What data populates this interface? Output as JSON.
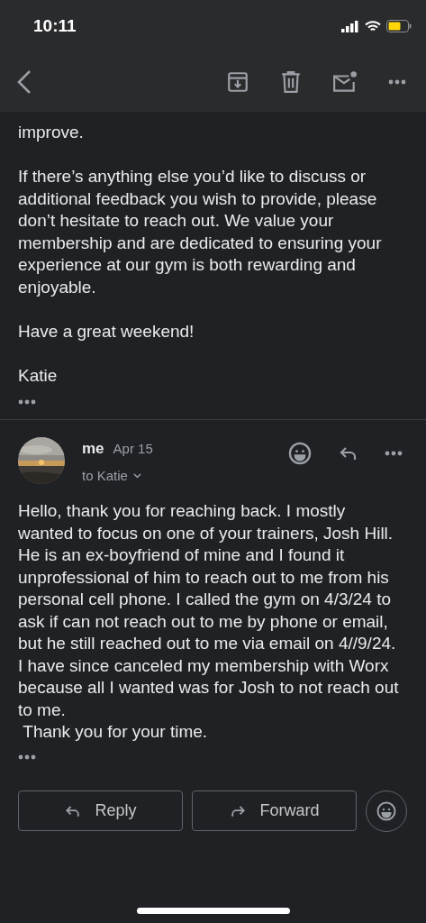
{
  "status_bar": {
    "time": "10:11"
  },
  "previous_message": {
    "paragraphs": [
      "improve.",
      "If there’s anything else you’d like to discuss or additional feedback you wish to provide, please don’t hesitate to reach out. We value your membership and are dedicated to ensuring your experience at our gym is both rewarding and enjoyable.",
      "Have a great weekend!",
      "Katie"
    ]
  },
  "message": {
    "sender": "me",
    "date": "Apr 15",
    "recipient": "to Katie",
    "paragraphs": [
      "Hello, thank you for reaching back. I mostly wanted to focus on one of your trainers, Josh Hill. He is an ex-boyfriend of mine and I found it unprofessional of him to reach out to me from his personal cell phone. I called the gym on 4/3/24 to ask if can not reach out to me by phone or email, but he still reached out to me via email on 4//9/24. I have since canceled my membership with Worx because all I wanted was for Josh to not reach out to me.",
      " Thank you for your time."
    ]
  },
  "actions": [
    {
      "kind": "reply",
      "label": "Reply"
    },
    {
      "kind": "forward",
      "label": "Forward"
    }
  ]
}
